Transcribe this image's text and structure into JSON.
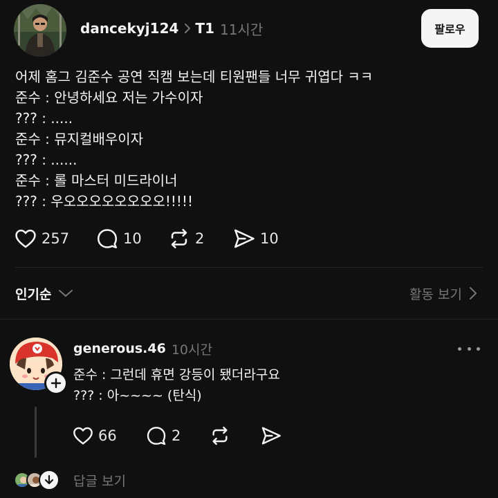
{
  "post": {
    "username": "dancekyj124",
    "topic": "T1",
    "time": "11시간",
    "follow_label": "팔로우",
    "lines": [
      "어제 홈그 김준수 공연 직캠 보는데 티원팬들 너무 귀엽다 ㅋㅋ",
      "준수 : 안녕하세요 저는 가수이자",
      "??? : .....",
      "준수 : 뮤지컬배우이자",
      "??? : ......",
      "준수 : 롤 마스터 미드라이너",
      "??? : 우오오오오오오오오!!!!!"
    ],
    "stats": {
      "likes": "257",
      "comments": "10",
      "reposts": "2",
      "shares": "10"
    }
  },
  "sort": {
    "label": "인기순",
    "activity_label": "활동 보기"
  },
  "reply": {
    "username": "generous.46",
    "time": "10시간",
    "lines": [
      "준수 : 그런데 휴면 강등이 됐더라구요",
      "??? : 아~~~~ (탄식)"
    ],
    "stats": {
      "likes": "66",
      "comments": "2"
    },
    "view_replies_label": "답글 보기"
  },
  "icons": {
    "heart": "heart-icon",
    "comment": "comment-icon",
    "repost": "repost-icon",
    "share": "send-icon",
    "chevron": "chevron-icon",
    "more": "more-icon",
    "plus": "plus-icon",
    "down": "arrow-down-icon"
  },
  "colors": {
    "background": "#101010",
    "text": "#f3f5f7",
    "muted": "#777777",
    "divider": "#262626",
    "button_bg": "#f5f5f5"
  }
}
